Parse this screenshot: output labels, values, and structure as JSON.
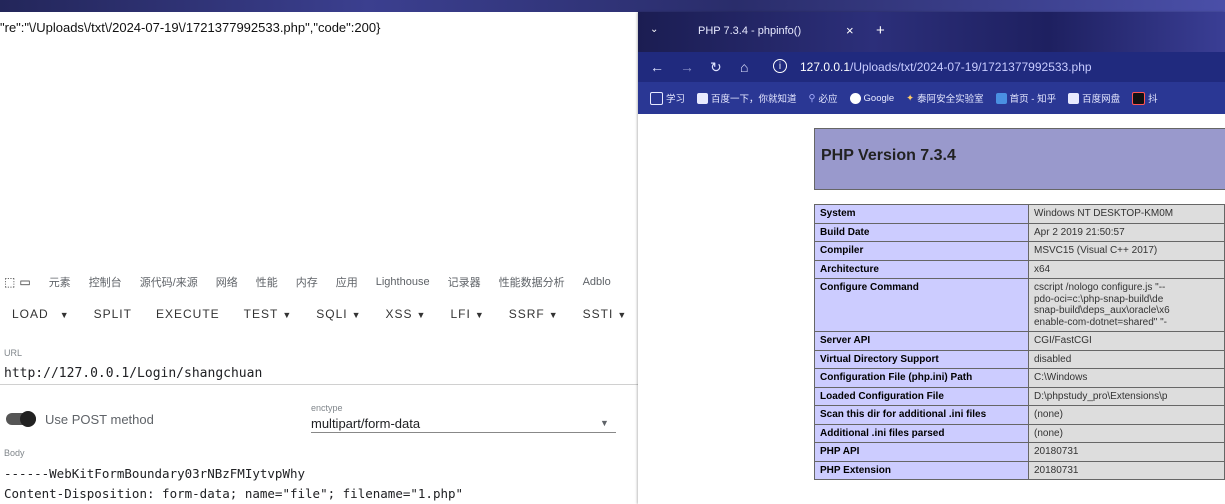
{
  "response": {
    "json_text": "\"re\":\"\\/Uploads\\/txt\\/2024-07-19\\/1721377992533.php\",\"code\":200}"
  },
  "devtools": {
    "tabs": [
      "元素",
      "控制台",
      "源代码/来源",
      "网络",
      "性能",
      "内存",
      "应用",
      "Lighthouse",
      "记录器",
      "性能数据分析",
      "Adblo"
    ]
  },
  "hackbar": {
    "buttons": {
      "load": "LOAD",
      "split": "SPLIT",
      "execute": "EXECUTE",
      "test": "TEST",
      "sqli": "SQLI",
      "xss": "XSS",
      "lfi": "LFI",
      "ssrf": "SSRF",
      "ssti": "SSTI"
    },
    "url_label": "URL",
    "url_value": "http://127.0.0.1/Login/shangchuan",
    "post_label": "Use POST method",
    "enctype_label": "enctype",
    "enctype_value": "multipart/form-data",
    "body_label": "Body",
    "body_line1": "------WebKitFormBoundary03rNBzFMIytvpWhy",
    "body_line2": "Content-Disposition: form-data; name=\"file\"; filename=\"1.php\""
  },
  "browser": {
    "tab_title": "PHP 7.3.4 - phpinfo()",
    "url_host": "127.0.0.1",
    "url_path": "/Uploads/txt/2024-07-19/1721377992533.php",
    "bookmarks": [
      "学习",
      "百度一下，你就知道",
      "必应",
      "Google",
      "泰阿安全实验室",
      "首页 - 知乎",
      "百度网盘",
      "抖"
    ]
  },
  "phpinfo": {
    "version_title": "PHP Version 7.3.4",
    "rows": [
      {
        "key": "System",
        "value": "Windows NT DESKTOP-KM0M"
      },
      {
        "key": "Build Date",
        "value": "Apr 2 2019 21:50:57"
      },
      {
        "key": "Compiler",
        "value": "MSVC15 (Visual C++ 2017)"
      },
      {
        "key": "Architecture",
        "value": "x64"
      },
      {
        "key": "Configure Command",
        "value": "cscript /nologo configure.js \"--\npdo-oci=c:\\php-snap-build\\de\nsnap-build\\deps_aux\\oracle\\x6\nenable-com-dotnet=shared\" \"-"
      },
      {
        "key": "Server API",
        "value": "CGI/FastCGI"
      },
      {
        "key": "Virtual Directory Support",
        "value": "disabled"
      },
      {
        "key": "Configuration File (php.ini) Path",
        "value": "C:\\Windows"
      },
      {
        "key": "Loaded Configuration File",
        "value": "D:\\phpstudy_pro\\Extensions\\p"
      },
      {
        "key": "Scan this dir for additional .ini files",
        "value": "(none)"
      },
      {
        "key": "Additional .ini files parsed",
        "value": "(none)"
      },
      {
        "key": "PHP API",
        "value": "20180731"
      },
      {
        "key": "PHP Extension",
        "value": "20180731"
      }
    ]
  },
  "colors": {
    "php_header": "#9999cc",
    "php_key_cell": "#ccccff",
    "php_value_cell": "#dddddd",
    "browser_nav": "#202a7e"
  }
}
